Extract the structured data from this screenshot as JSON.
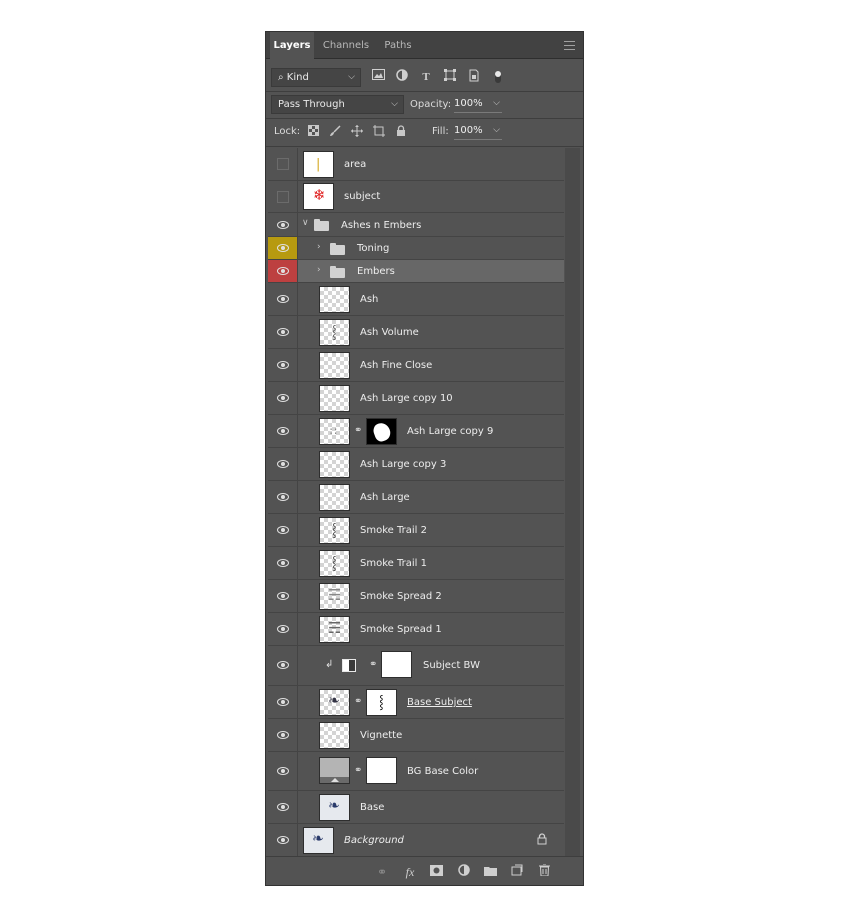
{
  "tabs": [
    {
      "label": "Layers"
    },
    {
      "label": "Channels"
    },
    {
      "label": "Paths"
    }
  ],
  "filter": {
    "kind_label": "Kind"
  },
  "blend": {
    "mode": "Pass Through",
    "opacity_label": "Opacity:",
    "opacity_value": "100%"
  },
  "lock": {
    "label": "Lock:",
    "fill_label": "Fill:",
    "fill_value": "100%"
  },
  "layers": [
    {
      "name": "area"
    },
    {
      "name": "subject"
    },
    {
      "name": "Ashes n Embers"
    },
    {
      "name": "Toning"
    },
    {
      "name": "Embers"
    },
    {
      "name": "Ash"
    },
    {
      "name": "Ash Volume"
    },
    {
      "name": "Ash Fine Close"
    },
    {
      "name": "Ash Large copy 10"
    },
    {
      "name": "Ash Large copy 9"
    },
    {
      "name": "Ash Large copy 3"
    },
    {
      "name": "Ash Large"
    },
    {
      "name": "Smoke Trail 2"
    },
    {
      "name": "Smoke Trail 1"
    },
    {
      "name": "Smoke Spread 2"
    },
    {
      "name": "Smoke Spread 1"
    },
    {
      "name": "Subject BW"
    },
    {
      "name": "Base Subject"
    },
    {
      "name": "Vignette"
    },
    {
      "name": "BG Base Color"
    },
    {
      "name": "Base"
    },
    {
      "name": "Background"
    }
  ],
  "label_colors": {
    "toning": "#b79a10",
    "embers": "#bd4040"
  },
  "icons": {
    "lock_background": "lock-icon",
    "fx": "fx"
  }
}
